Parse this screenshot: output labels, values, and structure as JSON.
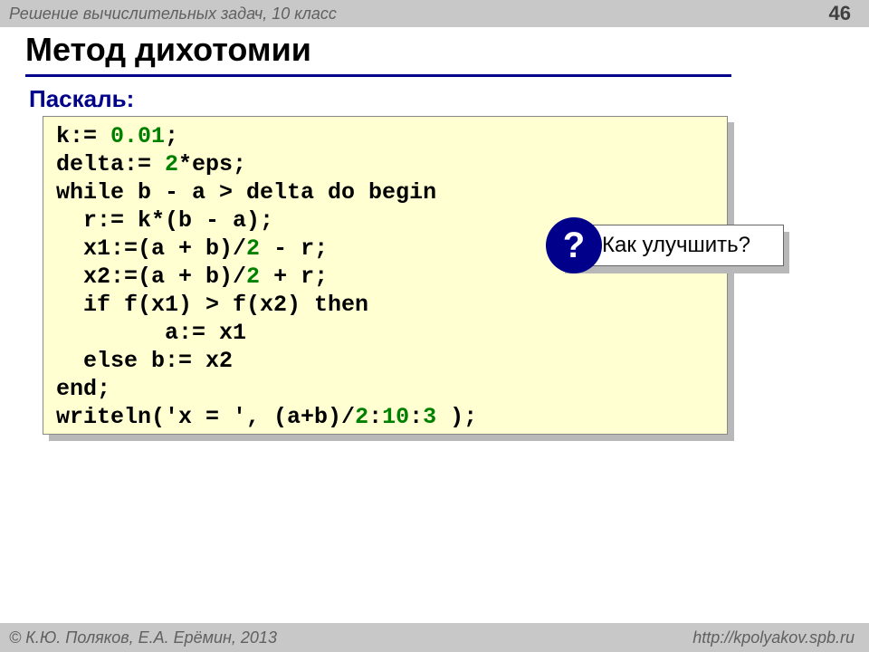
{
  "header": {
    "subject": "Решение вычислительных задач, 10 класс",
    "page": "46"
  },
  "title": "Метод дихотомии",
  "lang_label": "Паскаль:",
  "code": {
    "l1a": "k:= ",
    "l1n": "0.01",
    "l1b": ";",
    "l2a": "delta:= ",
    "l2n": "2",
    "l2b": "*eps;",
    "l3": "while b - a > delta do begin",
    "l4": "  r:= k*(b - a);",
    "l5a": "  x1:=(a + b)/",
    "l5n": "2",
    "l5b": " - r;",
    "l6a": "  x2:=(a + b)/",
    "l6n": "2",
    "l6b": " + r;",
    "l7": "  if f(x1) > f(x2) then",
    "l8": "        a:= x1",
    "l9": "  else b:= x2",
    "l10": "end;",
    "l11a": "writeln('x = ', (a+b)/",
    "l11n1": "2",
    "l11b": ":",
    "l11n2": "10",
    "l11c": ":",
    "l11n3": "3",
    "l11d": " );"
  },
  "callout": {
    "badge": "?",
    "text": "Как улучшить?"
  },
  "footer": {
    "left": "© К.Ю. Поляков, Е.А. Ерёмин, 2013",
    "right": "http://kpolyakov.spb.ru"
  }
}
